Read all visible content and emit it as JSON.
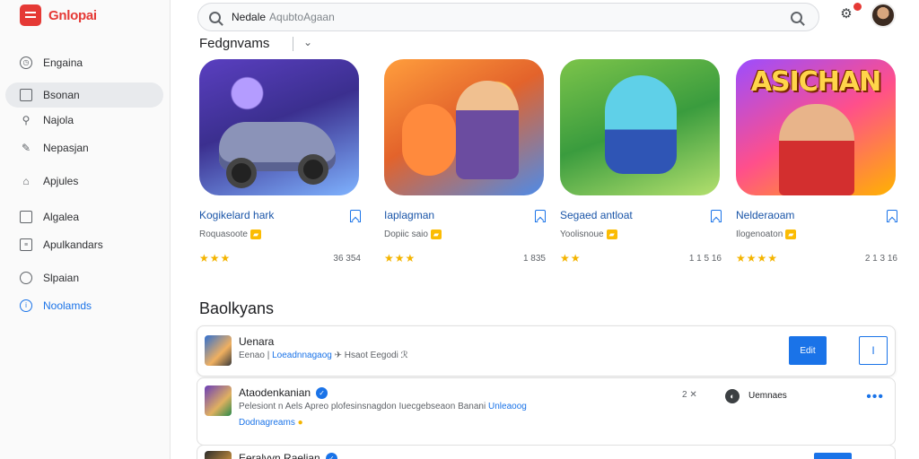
{
  "app": {
    "title": "Gnlopai"
  },
  "sidebar": {
    "items": [
      {
        "label": "Engaina",
        "icon": "clock-icon"
      },
      {
        "label": "Bsonan",
        "icon": "inbox-icon"
      },
      {
        "label": "Najola",
        "icon": "search-icon"
      },
      {
        "label": "Nepasjan",
        "icon": "edit-icon"
      },
      {
        "label": "Apjules",
        "icon": "home-icon"
      },
      {
        "label": "Algalea",
        "icon": "square-icon"
      },
      {
        "label": "Apulkandars",
        "icon": "list-icon"
      },
      {
        "label": "Slpaian",
        "icon": "circle-icon"
      },
      {
        "label": "Noolamds",
        "icon": "info-icon"
      }
    ]
  },
  "search": {
    "query": "Nedale",
    "placeholder": "AqubtoAgaan"
  },
  "featured": {
    "title": "Fedgnvams",
    "cards": [
      {
        "name": "Kogikelard hark",
        "sub": "Roquasoote",
        "stars": "★★★",
        "count": "36 354"
      },
      {
        "name": "Iaplagman",
        "sub": "Dopiic saio",
        "stars": "★★★",
        "count": "1 835"
      },
      {
        "name": "Segaed antloat",
        "sub": "Yoolisnoue",
        "stars": "★★",
        "count": "1 1 5 16"
      },
      {
        "name": "Nelderaoam",
        "sub": "Ilogenoaton",
        "stars": "★★★★",
        "count": "2 1 3 16"
      }
    ],
    "banner": "ASICHAN"
  },
  "bookmarks": {
    "title": "Baolkyans",
    "rows": [
      {
        "name": "Uenara",
        "sub_start": "Eenao |",
        "sub_link": "Loeadnnagaog",
        "sub_end": "✈  Hsaot Eegodi  ℛ",
        "primary_label": "Edit",
        "secondary_label": "I"
      },
      {
        "name": "Ataodenkanian",
        "sub": "Pelesiont n Aels Apreo plofesinsnagdon Iuecgebseaon Banani",
        "sub_link": "Unleaoog",
        "sub_link2": "Dodnagreams",
        "count": "2 ✕",
        "dev_name": "Uemnaes"
      },
      {
        "name": "Eeralvyn Raelian"
      }
    ]
  }
}
